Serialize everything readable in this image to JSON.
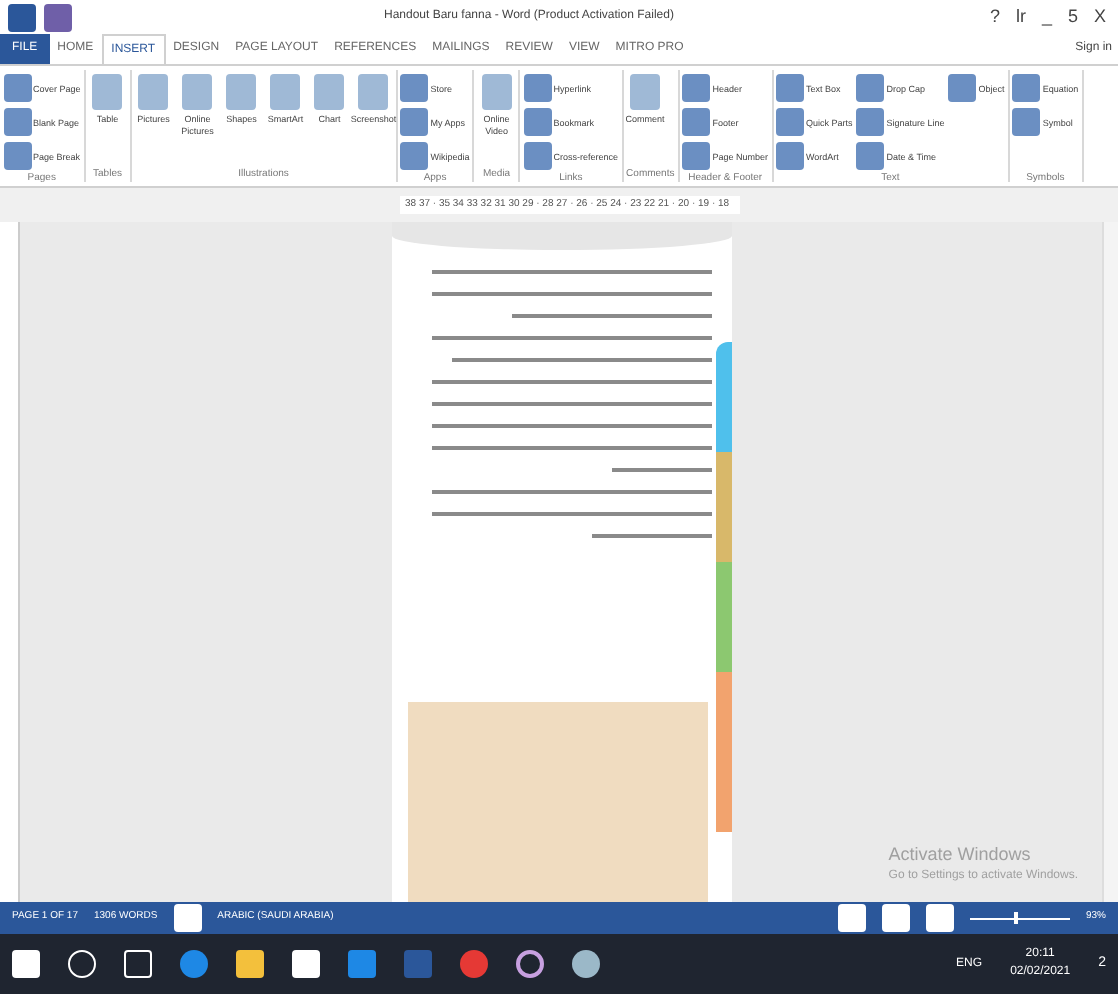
{
  "window": {
    "title": "Handout Baru fanna - Word (Product Activation Failed)",
    "controls": [
      "?",
      "lr",
      "_",
      "5",
      "X"
    ],
    "sign_in": "Sign in"
  },
  "tabs": [
    {
      "label": "FILE",
      "selected": false,
      "kind": "file"
    },
    {
      "label": "HOME",
      "selected": false,
      "kind": "tab"
    },
    {
      "label": "INSERT",
      "selected": true,
      "kind": "tab"
    },
    {
      "label": "DESIGN",
      "selected": false,
      "kind": "tab"
    },
    {
      "label": "PAGE LAYOUT",
      "selected": false,
      "kind": "tab"
    },
    {
      "label": "REFERENCES",
      "selected": false,
      "kind": "tab"
    },
    {
      "label": "MAILINGS",
      "selected": false,
      "kind": "tab"
    },
    {
      "label": "REVIEW",
      "selected": false,
      "kind": "tab"
    },
    {
      "label": "VIEW",
      "selected": false,
      "kind": "tab"
    },
    {
      "label": "MITRO PRO",
      "selected": false,
      "kind": "tab"
    }
  ],
  "ribbon": [
    {
      "group": "Pages",
      "kind": "small",
      "items": [
        "Cover Page",
        "Blank Page",
        "Page Break"
      ]
    },
    {
      "group": "Tables",
      "kind": "large",
      "items": [
        "Table"
      ]
    },
    {
      "group": "Illustrations",
      "kind": "large",
      "items": [
        "Pictures",
        "Online Pictures",
        "Shapes",
        "SmartArt",
        "Chart",
        "Screenshot"
      ]
    },
    {
      "group": "Apps",
      "kind": "small",
      "items": [
        "Store",
        "My Apps",
        "Wikipedia"
      ]
    },
    {
      "group": "Media",
      "kind": "large",
      "items": [
        "Online Video"
      ]
    },
    {
      "group": "Links",
      "kind": "small",
      "items": [
        "Hyperlink",
        "Bookmark",
        "Cross-reference"
      ]
    },
    {
      "group": "Comments",
      "kind": "large",
      "items": [
        "Comment"
      ]
    },
    {
      "group": "Header & Footer",
      "kind": "small",
      "items": [
        "Header",
        "Footer",
        "Page Number"
      ]
    },
    {
      "group": "Text",
      "kind": "small",
      "items": [
        "Text Box",
        "Quick Parts",
        "WordArt",
        "Drop Cap",
        "Signature Line",
        "Date & Time",
        "Object"
      ]
    },
    {
      "group": "Symbols",
      "kind": "small",
      "items": [
        "Equation",
        "Symbol"
      ]
    }
  ],
  "ruler": "38 37 · 35 34 33 32 31 30 29 · 28 27 · 26 · 25 24 · 23 22 21 · 20 · 19 · 18",
  "activation": {
    "title": "Activate Windows",
    "subtitle": "Go to Settings to activate Windows."
  },
  "status_bar": {
    "page": "PAGE 1 OF 17",
    "words": "1306 WORDS",
    "language": "ARABIC (SAUDI ARABIA)",
    "zoom": "93%",
    "zoom_slider": {
      "level": 0.45
    }
  },
  "taskbar": {
    "language": "ENG",
    "time": "20:11",
    "date": "02/02/2021",
    "notifications": "2"
  }
}
